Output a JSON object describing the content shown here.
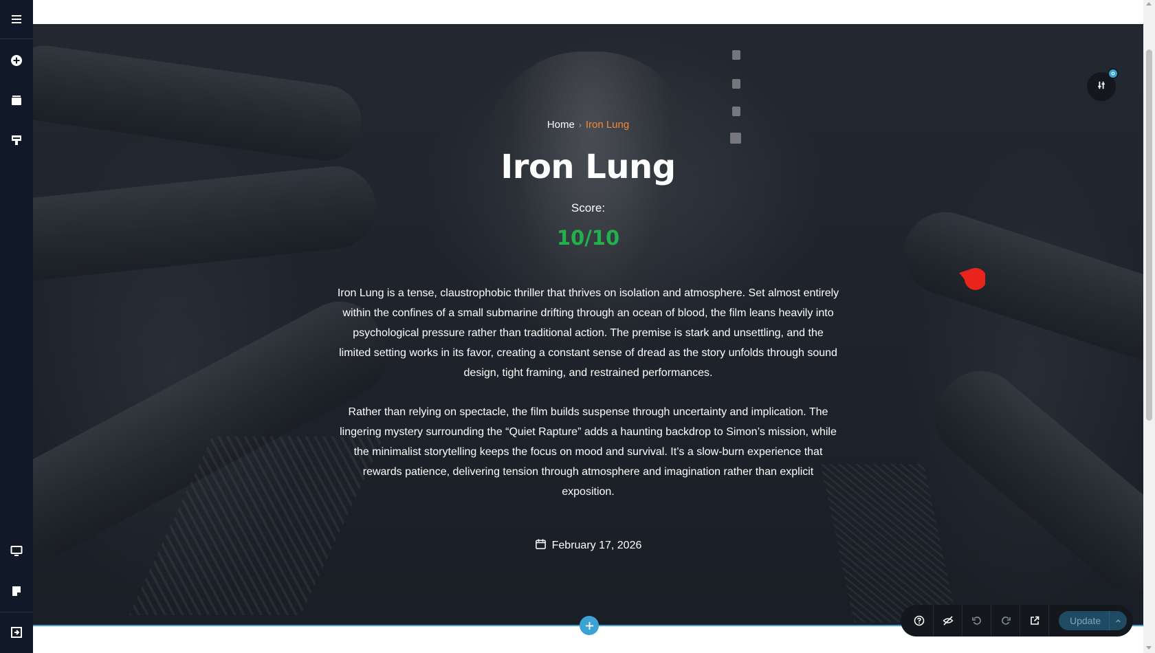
{
  "left_toolbar": {
    "items": [
      {
        "name": "menu-icon"
      },
      {
        "name": "add-element-icon"
      },
      {
        "name": "layers-icon"
      },
      {
        "name": "styles-icon"
      },
      {
        "name": "responsive-desktop-icon"
      },
      {
        "name": "notes-icon"
      },
      {
        "name": "exit-icon"
      }
    ]
  },
  "breadcrumb": {
    "home": "Home",
    "separator": "›",
    "current": "Iron Lung"
  },
  "post": {
    "title": "Iron Lung",
    "score_label": "Score:",
    "score_value": "10/10",
    "paragraph_1": "Iron Lung is a tense, claustrophobic thriller that thrives on isolation and atmosphere. Set almost entirely within the confines of a small submarine drifting through an ocean of blood, the film leans heavily into psychological pressure rather than traditional action. The premise is stark and unsettling, and the limited setting works in its favor, creating a constant sense of dread as the story unfolds through sound design, tight framing, and restrained performances.",
    "paragraph_2": "Rather than relying on spectacle, the film builds suspense through uncertainty and implication. The lingering mystery surrounding the “Quiet Rapture” adds a haunting backdrop to Simon’s mission, while the minimalist storytelling keeps the focus on mood and survival. It’s a slow-burn experience that rewards patience, delivering tension through atmosphere and imagination rather than explicit exposition.",
    "date": "February 17, 2026"
  },
  "action_bar": {
    "update_label": "Update"
  },
  "colors": {
    "accent": "#3ba3d4",
    "breadcrumb_current": "#f08a3c",
    "score": "#22b14c",
    "sidebar": "#111827"
  }
}
